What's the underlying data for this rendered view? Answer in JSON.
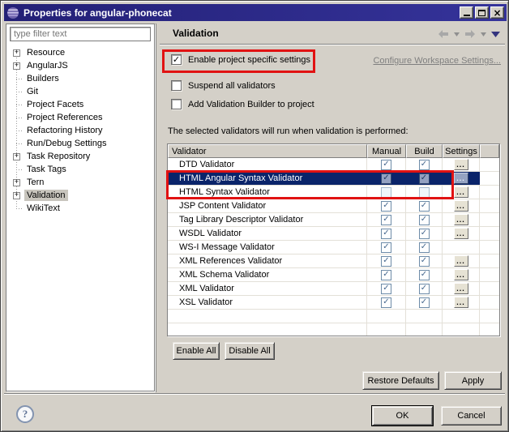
{
  "window": {
    "title": "Properties for angular-phonecat"
  },
  "colors": {
    "titlebar": "#232076",
    "selection": "#0A246A",
    "annotation_red": "#E11212",
    "link_gray": "#7F7F7F"
  },
  "sidebar": {
    "filter_placeholder": "type filter text",
    "tree": [
      {
        "label": "Resource",
        "expandable": true,
        "selected": false
      },
      {
        "label": "AngularJS",
        "expandable": true,
        "selected": false
      },
      {
        "label": "Builders",
        "expandable": false,
        "selected": false
      },
      {
        "label": "Git",
        "expandable": false,
        "selected": false
      },
      {
        "label": "Project Facets",
        "expandable": false,
        "selected": false
      },
      {
        "label": "Project References",
        "expandable": false,
        "selected": false
      },
      {
        "label": "Refactoring History",
        "expandable": false,
        "selected": false
      },
      {
        "label": "Run/Debug Settings",
        "expandable": false,
        "selected": false
      },
      {
        "label": "Task Repository",
        "expandable": true,
        "selected": false
      },
      {
        "label": "Task Tags",
        "expandable": false,
        "selected": false
      },
      {
        "label": "Tern",
        "expandable": true,
        "selected": false
      },
      {
        "label": "Validation",
        "expandable": true,
        "selected": true
      },
      {
        "label": "WikiText",
        "expandable": false,
        "selected": false
      }
    ]
  },
  "main": {
    "title": "Validation",
    "enable_specific": {
      "label": "Enable project specific settings",
      "checked": true
    },
    "configure_link": "Configure Workspace Settings...",
    "suspend": {
      "label": "Suspend all validators",
      "checked": false
    },
    "add_builder": {
      "label": "Add Validation Builder to project",
      "checked": false
    },
    "table_caption": "The selected validators will run when validation is performed:",
    "table": {
      "headers": [
        "Validator",
        "Manual",
        "Build",
        "Settings"
      ],
      "settings_icon": "...",
      "check_glyph": "✓",
      "rows": [
        {
          "name": "DTD Validator",
          "manual": true,
          "build": true,
          "settings": true,
          "selected": false
        },
        {
          "name": "HTML Angular Syntax Validator",
          "manual": true,
          "build": true,
          "settings": true,
          "selected": true
        },
        {
          "name": "HTML Syntax Validator",
          "manual": false,
          "build": false,
          "settings": true,
          "selected": false
        },
        {
          "name": "JSP Content Validator",
          "manual": true,
          "build": true,
          "settings": true,
          "selected": false
        },
        {
          "name": "Tag Library Descriptor Validator",
          "manual": true,
          "build": true,
          "settings": true,
          "selected": false
        },
        {
          "name": "WSDL Validator",
          "manual": true,
          "build": true,
          "settings": true,
          "selected": false
        },
        {
          "name": "WS-I Message Validator",
          "manual": true,
          "build": true,
          "settings": false,
          "selected": false
        },
        {
          "name": "XML References Validator",
          "manual": true,
          "build": true,
          "settings": true,
          "selected": false
        },
        {
          "name": "XML Schema Validator",
          "manual": true,
          "build": true,
          "settings": true,
          "selected": false
        },
        {
          "name": "XML Validator",
          "manual": true,
          "build": true,
          "settings": true,
          "selected": false
        },
        {
          "name": "XSL Validator",
          "manual": true,
          "build": true,
          "settings": true,
          "selected": false
        }
      ]
    },
    "buttons": {
      "enable_all": "Enable All",
      "disable_all": "Disable All",
      "restore_defaults": "Restore Defaults",
      "apply": "Apply"
    }
  },
  "footer": {
    "help": "?",
    "ok": "OK",
    "cancel": "Cancel"
  }
}
